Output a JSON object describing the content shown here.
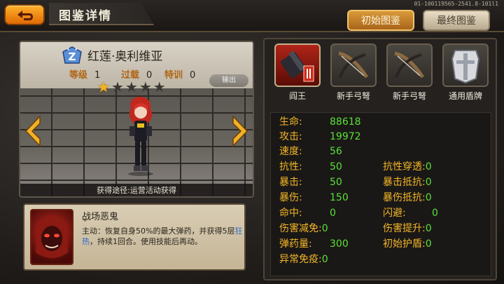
{
  "header": {
    "back_icon": "return-arrow-icon",
    "title": "图鉴详情",
    "version": "01-100119565-2541.8-101l1",
    "tab_initial": "初始图鉴",
    "tab_final": "最终图鉴"
  },
  "character": {
    "rank_badge": "Z",
    "name": "红莲·奥利维亚",
    "level_label": "等级",
    "level": "1",
    "overload_label": "过载",
    "overload": "0",
    "training_label": "特训",
    "training": "0",
    "stars_filled": 1,
    "stars_total": 5,
    "export_label": "输出",
    "source": "获得途径:运营活动获得"
  },
  "skill": {
    "name": "战场恶鬼",
    "quote": "\"",
    "desc_a": "主动：恢复自身50%的最大弹药，并获得5层",
    "desc_hl": "狂热",
    "desc_b": "，持续1回合。使用技能后再动。"
  },
  "equipment": [
    {
      "label": "阎王",
      "icon": "heavy-gun-icon",
      "selected": true
    },
    {
      "label": "新手弓弩",
      "icon": "crossbow-icon",
      "selected": false
    },
    {
      "label": "新手弓弩",
      "icon": "crossbow-icon",
      "selected": false
    },
    {
      "label": "通用盾牌",
      "icon": "shield-icon",
      "selected": false
    }
  ],
  "stats": {
    "hp_label": "生命:",
    "hp": "88618",
    "atk_label": "攻击:",
    "atk": "19972",
    "spd_label": "速度:",
    "spd": "56",
    "res_label": "抗性:",
    "res": "50",
    "crit_label": "暴击:",
    "crit": "50",
    "critdmg_label": "暴伤:",
    "critdmg": "150",
    "hit_label": "命中:",
    "hit": "0",
    "dmgred_label": "伤害减免:",
    "dmgred": "0",
    "ammo_label": "弹药量:",
    "ammo": "300",
    "immune_label": "异常免疫:",
    "immune": "0",
    "respen_label": "抗性穿透:",
    "respen": "0",
    "critres_label": "暴击抵抗:",
    "critres": "0",
    "critdmgres_label": "暴伤抵抗:",
    "critdmgres": "0",
    "dodge_label": "闪避:",
    "dodge": "0",
    "dmgup_label": "伤害提升:",
    "dmgup": "0",
    "shield_label": "初始护盾:",
    "shield": "0"
  },
  "colors": {
    "stat_label": "#f4b628",
    "stat_value": "#5ae03a",
    "accent_orange": "#e06a05"
  }
}
